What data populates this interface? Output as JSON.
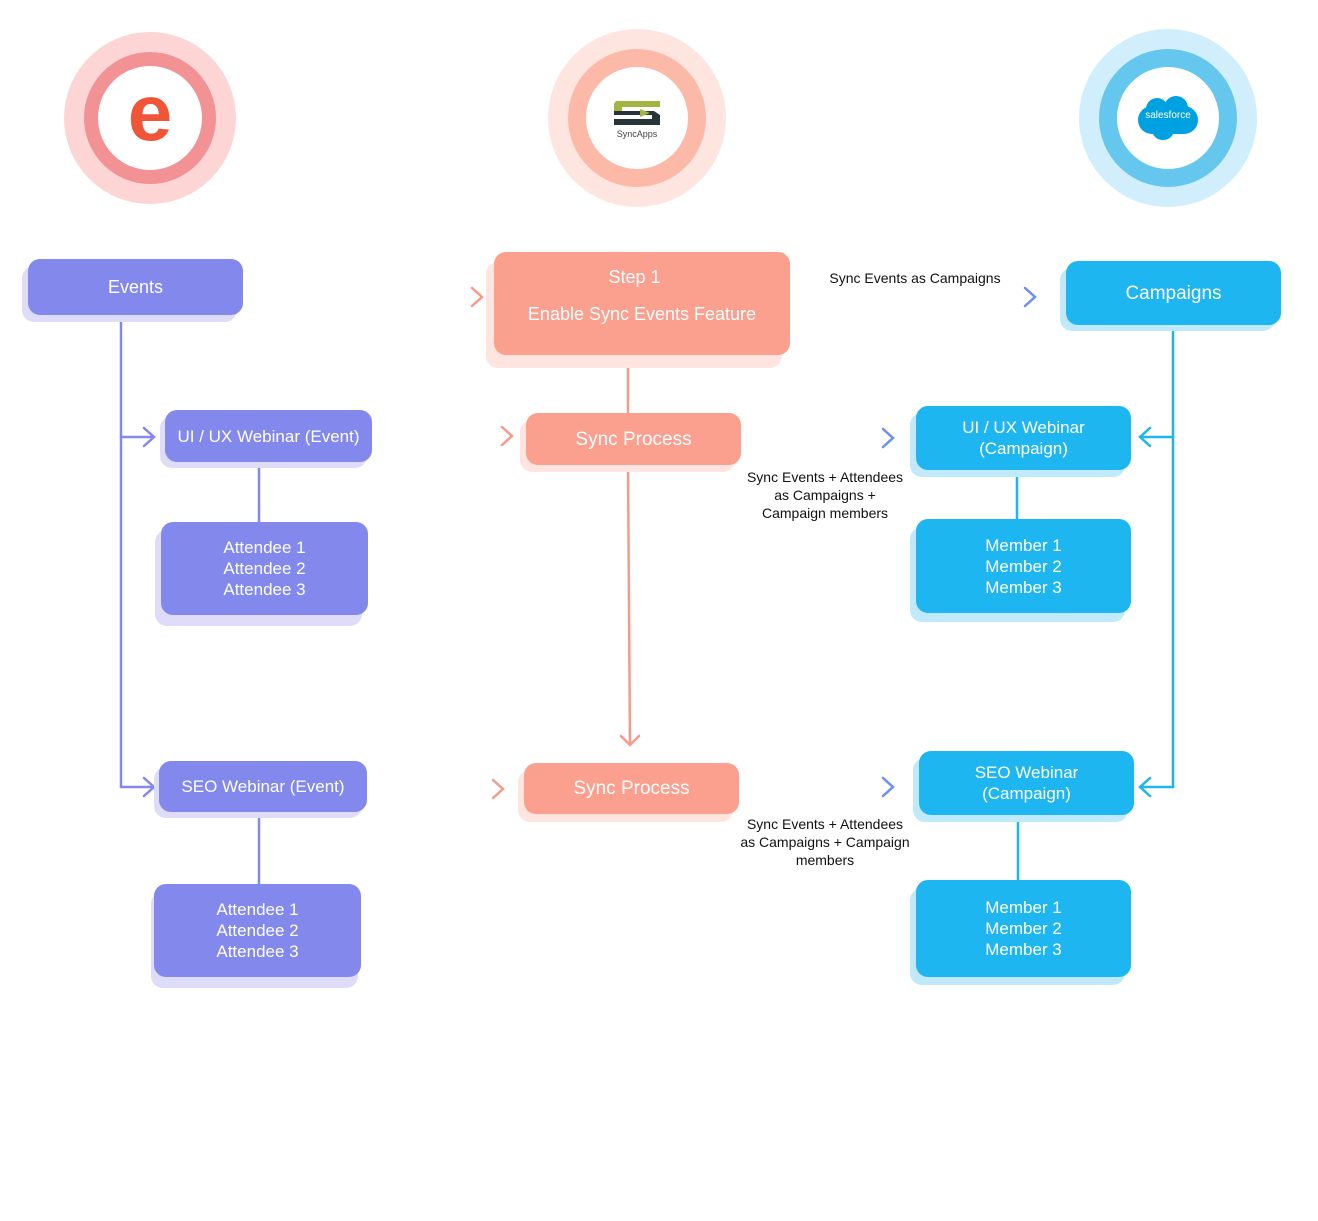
{
  "logos": {
    "eventbrite": {
      "name": "eventbrite-logo",
      "letter": "e",
      "color": "#f05537"
    },
    "syncapps": {
      "name": "syncapps-logo",
      "text": "SyncApps"
    },
    "salesforce": {
      "name": "salesforce-logo",
      "text": "salesforce",
      "color": "#00a1e0"
    }
  },
  "colors": {
    "eventbrite_side": "#8388ec",
    "syncapps_side": "#fba08e",
    "salesforce_side": "#1eb6f0"
  },
  "nodes": {
    "events": "Events",
    "step1_title": "Step 1",
    "step1_desc": "Enable Sync Events Feature",
    "campaigns": "Campaigns",
    "uiux_event": "UI / UX Webinar (Event)",
    "attendees_1": [
      "Attendee 1",
      "Attendee 2",
      "Attendee 3"
    ],
    "seo_event": "SEO Webinar (Event)",
    "attendees_2": [
      "Attendee 1",
      "Attendee 2",
      "Attendee 3"
    ],
    "sync_process_1": "Sync Process",
    "sync_process_2": "Sync Process",
    "uiux_campaign": [
      "UI / UX Webinar",
      "(Campaign)"
    ],
    "members_1": [
      "Member 1",
      "Member 2",
      "Member 3"
    ],
    "seo_campaign": [
      "SEO Webinar",
      "(Campaign)"
    ],
    "members_2": [
      "Member 1",
      "Member 2",
      "Member 3"
    ]
  },
  "edge_labels": {
    "top": "Sync Events as Campaigns",
    "middle": [
      "Sync Events + Attendees",
      "as Campaigns +",
      "Campaign members"
    ],
    "bottom": [
      "Sync Events + Attendees",
      "as Campaigns + Campaign",
      "members"
    ]
  }
}
